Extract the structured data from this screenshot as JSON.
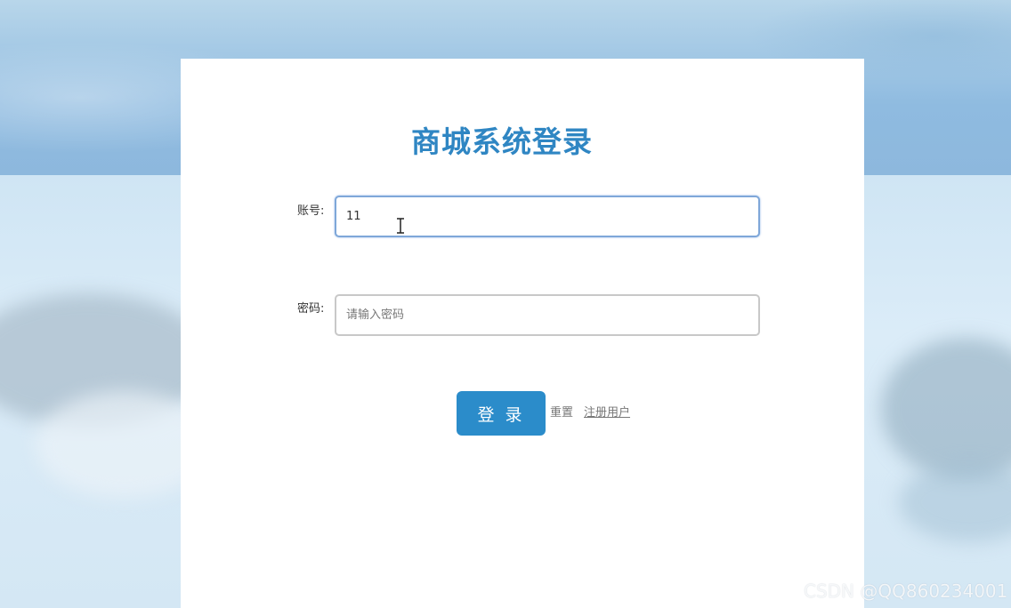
{
  "login": {
    "title": "商城系统登录",
    "account_label": "账号:",
    "account_value": "11",
    "password_label": "密码:",
    "password_placeholder": "请输入密码",
    "login_button": "登 录",
    "reset_link": "重置",
    "register_link": "注册用户"
  },
  "watermark": "CSDN @QQ860234001",
  "colors": {
    "accent": "#2b8cca",
    "title": "#2f86c3"
  }
}
